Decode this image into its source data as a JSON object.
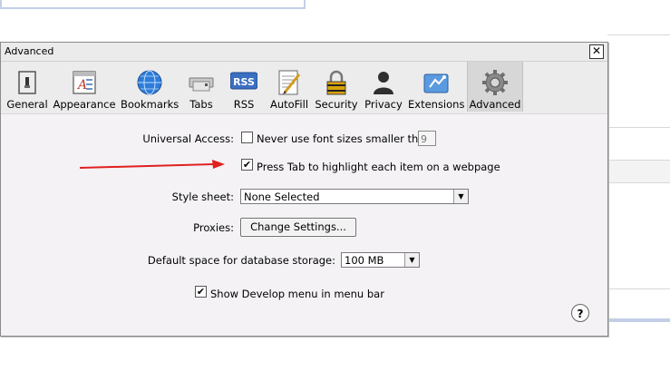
{
  "window": {
    "title": "Advanced",
    "close_label": "✕"
  },
  "toolbar": {
    "items": [
      {
        "label": "General",
        "icon": "general-icon"
      },
      {
        "label": "Appearance",
        "icon": "appearance-icon"
      },
      {
        "label": "Bookmarks",
        "icon": "bookmarks-icon"
      },
      {
        "label": "Tabs",
        "icon": "tabs-icon"
      },
      {
        "label": "RSS",
        "icon": "rss-icon"
      },
      {
        "label": "AutoFill",
        "icon": "autofill-icon"
      },
      {
        "label": "Security",
        "icon": "security-icon"
      },
      {
        "label": "Privacy",
        "icon": "privacy-icon"
      },
      {
        "label": "Extensions",
        "icon": "extensions-icon"
      },
      {
        "label": "Advanced",
        "icon": "advanced-icon"
      }
    ],
    "active": "Advanced",
    "rss_badge": "RSS"
  },
  "settings": {
    "universal_access_label": "Universal Access:",
    "min_font_label": "Never use font sizes smaller than",
    "min_font_checked": false,
    "min_font_value": "9",
    "tab_highlight_label": "Press Tab to highlight each item on a webpage",
    "tab_highlight_checked": true,
    "stylesheet_label": "Style sheet:",
    "stylesheet_value": "None Selected",
    "proxies_label": "Proxies:",
    "proxies_button": "Change Settings...",
    "db_storage_label": "Default space for database storage:",
    "db_storage_value": "100 MB",
    "develop_menu_label": "Show Develop menu in menu bar",
    "develop_menu_checked": true,
    "help_label": "?"
  },
  "check_mark": "✔",
  "dropdown_arrow": "▼",
  "colors": {
    "annotation_arrow": "#e02020",
    "accent_border": "#c3cfe6"
  }
}
